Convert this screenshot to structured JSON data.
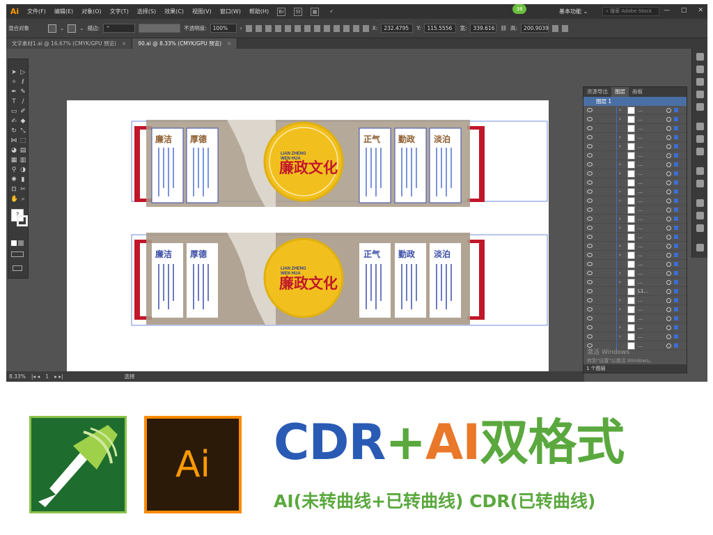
{
  "app": {
    "logo": "Ai",
    "menu": [
      "文件(F)",
      "编辑(E)",
      "对象(O)",
      "文字(T)",
      "选择(S)",
      "效果(C)",
      "视图(V)",
      "窗口(W)",
      "帮助(H)"
    ],
    "badge": "38",
    "workspace": "基本功能",
    "stock_search_placeholder": "搜索 Adobe Stock",
    "window_controls": [
      "—",
      "□",
      "✕"
    ]
  },
  "control_bar": {
    "object_type": "混合对象",
    "stroke_label": "描边:",
    "opacity_label": "不透明度:",
    "opacity_value": "100%",
    "x_label": "X:",
    "x_value": "232.4795",
    "y_label": "Y:",
    "y_value": "115.5556",
    "w_label": "宽:",
    "w_value": "339.616",
    "h_label": "高:",
    "h_value": "200.9039"
  },
  "tabs": [
    {
      "label": "文字素材1.ai @ 16.67% (CMYK/GPU 预览)",
      "close": "×",
      "active": false
    },
    {
      "label": "90.ai @ 8.33% (CMYK/GPU 预览)",
      "close": "×",
      "active": true
    }
  ],
  "status_bar": {
    "zoom": "8.33%",
    "page": "1",
    "tool_status": "选择"
  },
  "layers_panel": {
    "tabs": [
      "资源导出",
      "图层",
      "画板"
    ],
    "active_tab": "图层",
    "layer_name": "图层 1",
    "rows": [
      {
        "name": "…"
      },
      {
        "name": "…"
      },
      {
        "name": "…"
      },
      {
        "name": "…"
      },
      {
        "name": "…"
      },
      {
        "name": "…"
      },
      {
        "name": "…"
      },
      {
        "name": "…"
      },
      {
        "name": "…"
      },
      {
        "name": "…"
      },
      {
        "name": "…"
      },
      {
        "name": "…"
      },
      {
        "name": "…"
      },
      {
        "name": "…"
      },
      {
        "name": "…"
      },
      {
        "name": "…"
      },
      {
        "name": "…"
      },
      {
        "name": "…"
      },
      {
        "name": "…"
      },
      {
        "name": "…"
      },
      {
        "name": "L1…"
      },
      {
        "name": "…"
      },
      {
        "name": "…"
      },
      {
        "name": "…"
      },
      {
        "name": "…"
      },
      {
        "name": "…"
      },
      {
        "name": "…"
      }
    ],
    "footer": "1 个图层"
  },
  "windows_watermark": {
    "line1": "激活 Windows",
    "line2": "转到\"设置\"以激活 Windows。"
  },
  "design": {
    "center_title": "廉政文化",
    "center_pinyin_1": "LIAN ZHENG",
    "center_pinyin_2": "WEN HUA",
    "left_panels": [
      "廉洁",
      "厚德"
    ],
    "right_panels": [
      "正气",
      "勤政",
      "淡泊"
    ],
    "colors": {
      "frame_red": "#c0172a",
      "wall_tan": "#a89a88",
      "circle_yellow": "#f2c01e",
      "panel_blue": "#3a4ea8"
    }
  },
  "promo": {
    "ai_logo_text": "Ai",
    "headline_cdr": "CDR",
    "headline_plus": "+",
    "headline_ai": "AI",
    "headline_cn": "双格式",
    "subline": "AI(未转曲线+已转曲线) CDR(已转曲线)"
  }
}
